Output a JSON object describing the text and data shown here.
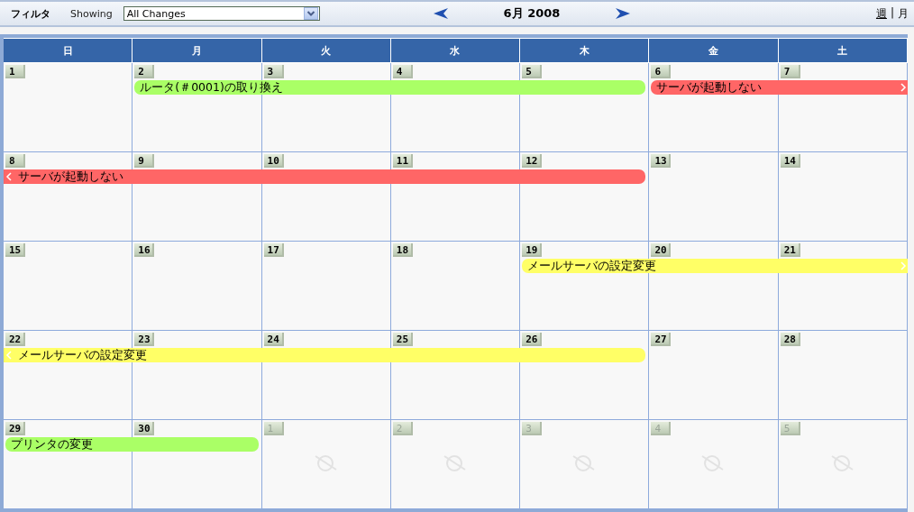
{
  "toolbar": {
    "filter_label": "フィルタ",
    "showing_label": "Showing",
    "filter_select": {
      "value": "All Changes"
    },
    "title": "6月 2008",
    "views": [
      {
        "label": "週",
        "selected": false
      },
      {
        "label": "月",
        "selected": true
      }
    ],
    "view_separator": "|"
  },
  "weekdays": [
    "日",
    "月",
    "火",
    "水",
    "木",
    "金",
    "土"
  ],
  "weeks": [
    {
      "days": [
        {
          "label": "1",
          "in_month": true
        },
        {
          "label": "2",
          "in_month": true
        },
        {
          "label": "3",
          "in_month": true
        },
        {
          "label": "4",
          "in_month": true
        },
        {
          "label": "5",
          "in_month": true
        },
        {
          "label": "6",
          "in_month": true
        },
        {
          "label": "7",
          "in_month": true
        }
      ],
      "events": [
        {
          "title": "ルータ(＃0001)の取り換え",
          "color": "#aaff66",
          "covers": [
            false,
            true,
            true,
            true,
            true,
            false,
            false
          ],
          "continues_before": false,
          "continues_after": false
        },
        {
          "title": "サーバが起動しない",
          "color": "#ff6666",
          "covers": [
            false,
            false,
            false,
            false,
            false,
            true,
            true
          ],
          "continues_before": false,
          "continues_after": true
        }
      ]
    },
    {
      "days": [
        {
          "label": "8",
          "in_month": true
        },
        {
          "label": "9",
          "in_month": true
        },
        {
          "label": "10",
          "in_month": true
        },
        {
          "label": "11",
          "in_month": true
        },
        {
          "label": "12",
          "in_month": true
        },
        {
          "label": "13",
          "in_month": true
        },
        {
          "label": "14",
          "in_month": true
        }
      ],
      "events": [
        {
          "title": "サーバが起動しない",
          "color": "#ff6666",
          "covers": [
            true,
            true,
            true,
            true,
            true,
            false,
            false
          ],
          "continues_before": true,
          "continues_after": false
        }
      ]
    },
    {
      "days": [
        {
          "label": "15",
          "in_month": true
        },
        {
          "label": "16",
          "in_month": true
        },
        {
          "label": "17",
          "in_month": true
        },
        {
          "label": "18",
          "in_month": true
        },
        {
          "label": "19",
          "in_month": true
        },
        {
          "label": "20",
          "in_month": true
        },
        {
          "label": "21",
          "in_month": true
        }
      ],
      "events": [
        {
          "title": "メールサーバの設定変更",
          "color": "#ffff66",
          "covers": [
            false,
            false,
            false,
            false,
            true,
            true,
            true
          ],
          "continues_before": false,
          "continues_after": true
        }
      ]
    },
    {
      "days": [
        {
          "label": "22",
          "in_month": true
        },
        {
          "label": "23",
          "in_month": true
        },
        {
          "label": "24",
          "in_month": true
        },
        {
          "label": "25",
          "in_month": true
        },
        {
          "label": "26",
          "in_month": true
        },
        {
          "label": "27",
          "in_month": true
        },
        {
          "label": "28",
          "in_month": true
        }
      ],
      "events": [
        {
          "title": "メールサーバの設定変更",
          "color": "#ffff66",
          "covers": [
            true,
            true,
            true,
            true,
            true,
            false,
            false
          ],
          "continues_before": true,
          "continues_after": false
        }
      ]
    },
    {
      "days": [
        {
          "label": "29",
          "in_month": true
        },
        {
          "label": "30",
          "in_month": true
        },
        {
          "label": "1",
          "in_month": false
        },
        {
          "label": "2",
          "in_month": false
        },
        {
          "label": "3",
          "in_month": false
        },
        {
          "label": "4",
          "in_month": false
        },
        {
          "label": "5",
          "in_month": false
        }
      ],
      "events": [
        {
          "title": "プリンタの変更",
          "color": "#aaff66",
          "covers": [
            true,
            true,
            false,
            false,
            false,
            false,
            false
          ],
          "continues_before": false,
          "continues_after": false
        }
      ]
    }
  ]
}
